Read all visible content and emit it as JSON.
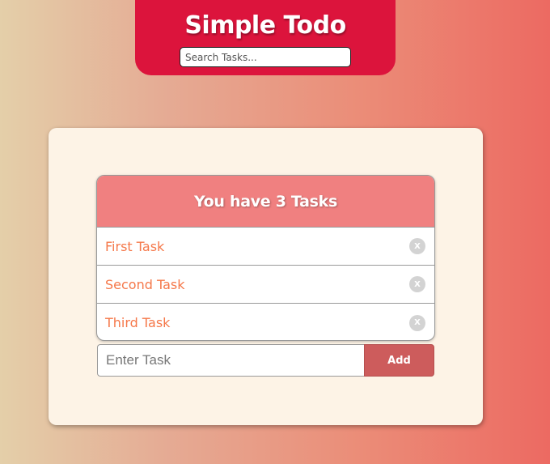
{
  "header": {
    "title": "Simple Todo",
    "search_placeholder": "Search Tasks..."
  },
  "list": {
    "heading": "You have 3 Tasks",
    "tasks": [
      {
        "label": "First Task",
        "delete_label": "X"
      },
      {
        "label": "Second Task",
        "delete_label": "X"
      },
      {
        "label": "Third Task",
        "delete_label": "X"
      }
    ]
  },
  "form": {
    "input_placeholder": "Enter Task",
    "add_label": "Add"
  },
  "colors": {
    "header_bg": "#dc143c",
    "list_header_bg": "#f08080",
    "task_text": "#f5784a",
    "add_button_bg": "#cd5c5c",
    "card_bg": "#fdf3e6"
  }
}
